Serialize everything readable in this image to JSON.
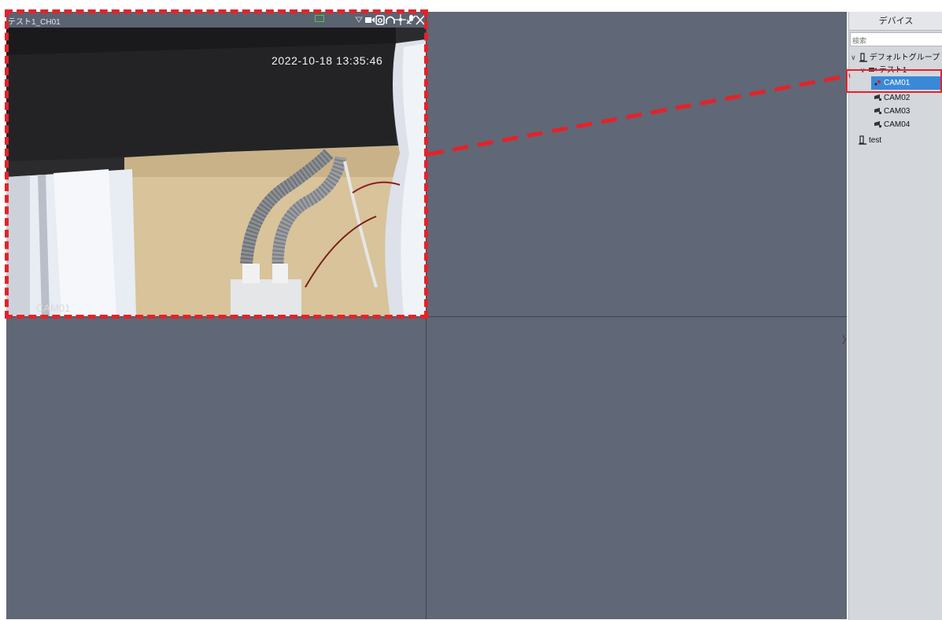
{
  "panel": {
    "header": "デバイス",
    "search_placeholder": "検索",
    "tree": {
      "default_group": "デフォルトグループ",
      "device": "テスト1",
      "cameras": [
        "CAM01",
        "CAM02",
        "CAM03",
        "CAM04"
      ],
      "selected_camera": "CAM01",
      "other_group": "test"
    }
  },
  "video": {
    "active_cell_title": "テスト1_CH01",
    "timestamp": "2022-10-18 13:35:46",
    "camera_overlay": "CAM01"
  },
  "colors": {
    "grid_bg": "#606776",
    "panel_bg": "#d4d7dc",
    "selection": "#3a89d8",
    "annotation": "#e52229"
  },
  "icons": [
    "record-icon",
    "snapshot-icon",
    "audio-icon",
    "ptz-icon",
    "talk-icon",
    "close-icon",
    "group-icon",
    "device-icon",
    "camera-icon",
    "collapse-icon"
  ]
}
